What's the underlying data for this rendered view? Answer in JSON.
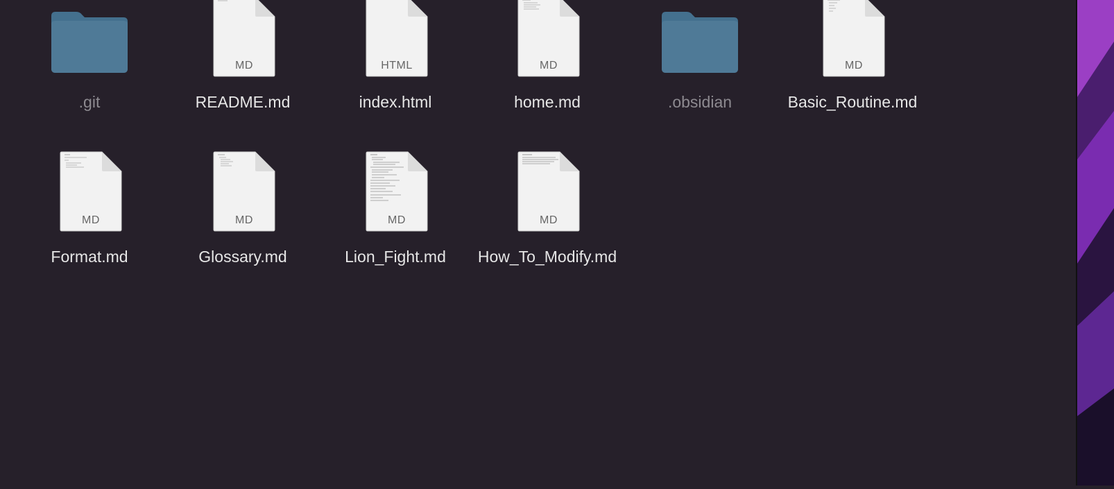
{
  "finder": {
    "items": [
      {
        "name": ".git",
        "kind": "folder",
        "dim": true,
        "type_label": ""
      },
      {
        "name": "README.md",
        "kind": "doc",
        "dim": false,
        "type_label": "MD"
      },
      {
        "name": "index.html",
        "kind": "doc",
        "dim": false,
        "type_label": "HTML"
      },
      {
        "name": "home.md",
        "kind": "doc",
        "dim": false,
        "type_label": "MD"
      },
      {
        "name": ".obsidian",
        "kind": "folder",
        "dim": true,
        "type_label": ""
      },
      {
        "name": "Basic_Routine.md",
        "kind": "doc",
        "dim": false,
        "type_label": "MD"
      },
      {
        "name": "Format.md",
        "kind": "doc",
        "dim": false,
        "type_label": "MD"
      },
      {
        "name": "Glossary.md",
        "kind": "doc",
        "dim": false,
        "type_label": "MD"
      },
      {
        "name": "Lion_Fight.md",
        "kind": "doc",
        "dim": false,
        "type_label": "MD"
      },
      {
        "name": "How_To_Modify.md",
        "kind": "doc",
        "dim": false,
        "type_label": "MD"
      }
    ]
  },
  "colors": {
    "background": "#26202a",
    "folder": "#4f7a97",
    "folder_tab": "#44708e",
    "doc_page": "#f2f2f2",
    "label_normal": "#e6e6e6",
    "label_dim": "#8d8a90"
  },
  "icons": {
    "folder": "folder-icon",
    "document": "document-icon"
  }
}
